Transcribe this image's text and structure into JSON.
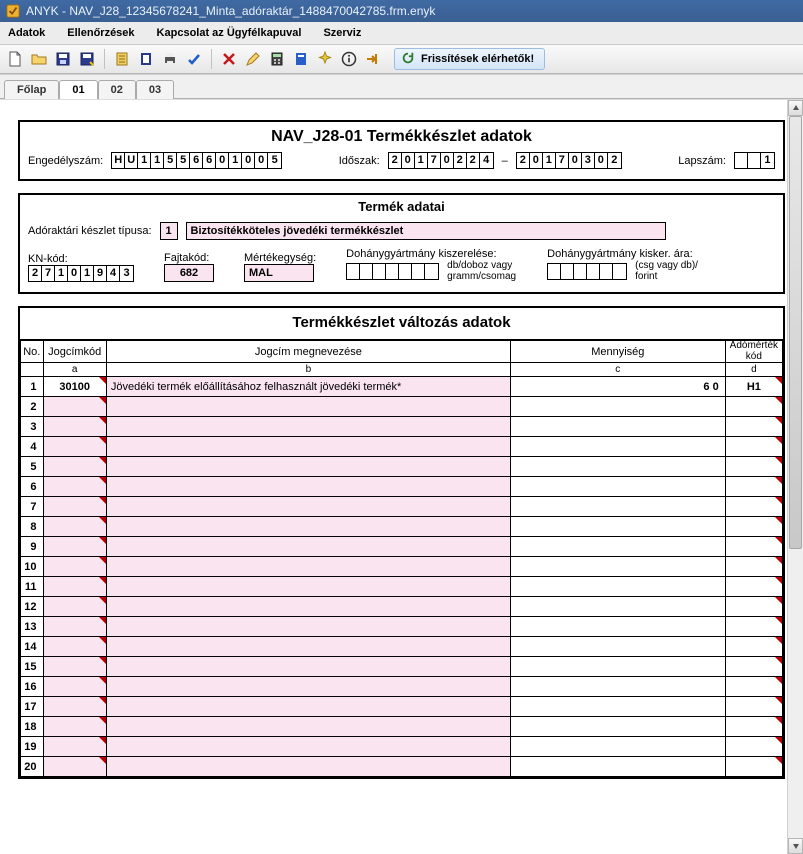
{
  "window": {
    "title": "ANYK - NAV_J28_12345678241_Minta_adóraktár_1488470042785.frm.enyk"
  },
  "menu": [
    "Adatok",
    "Ellenőrzések",
    "Kapcsolat az Ügyfélkapuval",
    "Szerviz"
  ],
  "toolbar": {
    "update_label": "Frissítések elérhetők!"
  },
  "tabs": [
    "Főlap",
    "01",
    "02",
    "03"
  ],
  "active_tab": 1,
  "header": {
    "title": "NAV_J28-01 Termékkészlet adatok",
    "permit_label": "Engedélyszám:",
    "permit_cells": [
      "H",
      "U",
      "1",
      "1",
      "5",
      "5",
      "6",
      "6",
      "0",
      "1",
      "0",
      "0",
      "5"
    ],
    "period_label": "Időszak:",
    "period_from_cells": [
      "2",
      "0",
      "1",
      "7",
      "0",
      "2",
      "2",
      "4"
    ],
    "period_sep": "–",
    "period_to_cells": [
      "2",
      "0",
      "1",
      "7",
      "0",
      "3",
      "0",
      "2"
    ],
    "page_label": "Lapszám:",
    "page_cells": [
      "",
      "",
      "1"
    ]
  },
  "product": {
    "title": "Termék adatai",
    "stock_type_label": "Adóraktári készlet típusa:",
    "stock_type_value_cell": "1",
    "stock_type_text": "Biztosítékköteles jövedéki termékkészlet",
    "kn_label": "KN-kód:",
    "kn_cells": [
      "2",
      "7",
      "1",
      "0",
      "1",
      "9",
      "4",
      "3"
    ],
    "species_label": "Fajtakód:",
    "species_value": "682",
    "unit_label": "Mértékegység:",
    "unit_value": "MAL",
    "tobacco_pack_label": "Dohánygyártmány kiszerelése:",
    "tobacco_pack_hint": "db/doboz vagy gramm/csomag",
    "tobacco_price_label": "Dohánygyártmány kisker. ára:",
    "tobacco_price_hint": "(csg vagy db)/ forint"
  },
  "changes": {
    "title": "Termékkészlet változás adatok",
    "columns": {
      "no": "No.",
      "code": "Jogcímkód",
      "name": "Jogcím megnevezése",
      "qty": "Mennyiség",
      "tax": "Adómérték kód"
    },
    "sub_columns": {
      "a": "a",
      "b": "b",
      "c": "c",
      "d": "d"
    },
    "rows": [
      {
        "no": 1,
        "code": "30100",
        "name": "Jövedéki termék előállításához felhasznált jövedéki termék*",
        "qty": "6 0",
        "tax": "H1"
      },
      {
        "no": 2
      },
      {
        "no": 3
      },
      {
        "no": 4
      },
      {
        "no": 5
      },
      {
        "no": 6
      },
      {
        "no": 7
      },
      {
        "no": 8
      },
      {
        "no": 9
      },
      {
        "no": 10
      },
      {
        "no": 11
      },
      {
        "no": 12
      },
      {
        "no": 13
      },
      {
        "no": 14
      },
      {
        "no": 15
      },
      {
        "no": 16
      },
      {
        "no": 17
      },
      {
        "no": 18
      },
      {
        "no": 19
      },
      {
        "no": 20
      }
    ]
  }
}
